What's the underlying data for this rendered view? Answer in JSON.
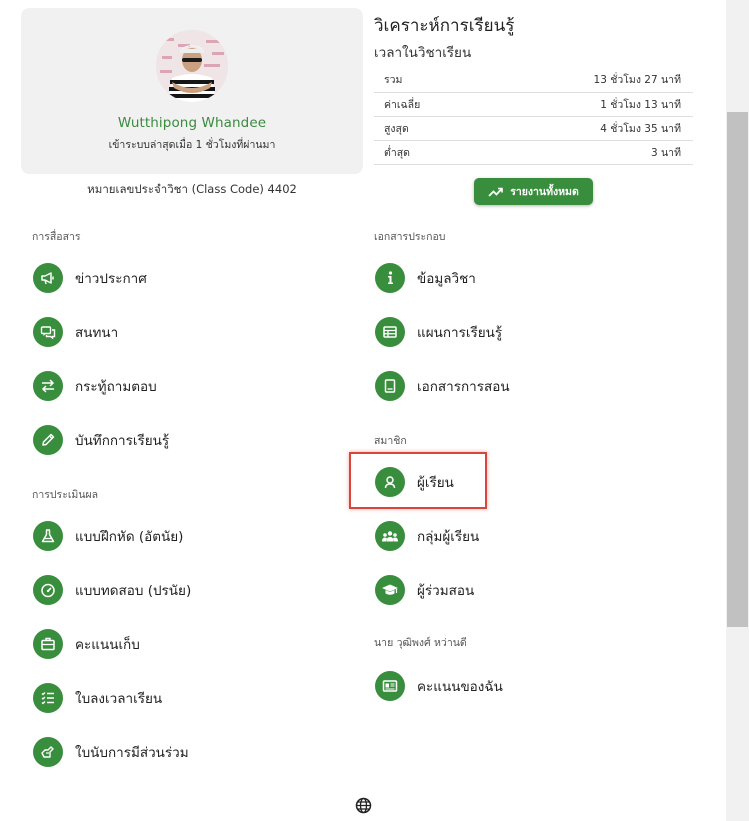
{
  "profile": {
    "name": "Wutthipong Whandee",
    "last_login": "เข้าระบบล่าสุดเมื่อ 1 ชั่วโมงที่ผ่านมา",
    "class_code": "หมายเลขประจำวิชา (Class Code) 4402"
  },
  "analysis": {
    "title": "วิเคราะห์การเรียนรู้",
    "subtitle": "เวลาในวิชาเรียน",
    "stats": [
      {
        "label": "รวม",
        "value": "13 ชั่วโมง 27 นาที"
      },
      {
        "label": "ค่าเฉลี่ย",
        "value": "1 ชั่วโมง 13 นาที"
      },
      {
        "label": "สูงสุด",
        "value": "4 ชั่วโมง 35 นาที"
      },
      {
        "label": "ต่ำสุด",
        "value": "3 นาที"
      }
    ],
    "report_button": "รายงานทั้งหมด"
  },
  "sections": {
    "communication": {
      "label": "การสื่อสาร",
      "items": [
        "ข่าวประกาศ",
        "สนทนา",
        "กระทู้ถามตอบ",
        "บันทึกการเรียนรู้"
      ]
    },
    "assessment": {
      "label": "การประเมินผล",
      "items": [
        "แบบฝึกหัด (อัตนัย)",
        "แบบทดสอบ (ปรนัย)",
        "คะแนนเก็บ",
        "ใบลงเวลาเรียน",
        "ใบนับการมีส่วนร่วม"
      ]
    },
    "documents": {
      "label": "เอกสารประกอบ",
      "items": [
        "ข้อมูลวิชา",
        "แผนการเรียนรู้",
        "เอกสารการสอน"
      ]
    },
    "members": {
      "label": "สมาชิก",
      "items": [
        "ผู้เรียน",
        "กลุ่มผู้เรียน",
        "ผู้ร่วมสอน"
      ]
    },
    "personal": {
      "label": "นาย วุฒิพงศ์ หว่านดี",
      "items": [
        "คะแนนของฉัน"
      ]
    }
  },
  "colors": {
    "accent": "#388e3c",
    "name_green": "#3b8b3f",
    "highlight": "#d9443b"
  },
  "icons": {
    "communication": [
      "megaphone-icon",
      "chat-icon",
      "exchange-icon",
      "pencil-icon"
    ],
    "assessment": [
      "flask-icon",
      "speedometer-icon",
      "briefcase-icon",
      "checklist-icon",
      "hand-icon"
    ],
    "documents": [
      "info-icon",
      "table-icon",
      "book-icon"
    ],
    "members": [
      "user-icon",
      "users-icon",
      "graduation-cap-icon"
    ],
    "personal": [
      "id-card-icon"
    ],
    "footer": "globe-icon"
  }
}
